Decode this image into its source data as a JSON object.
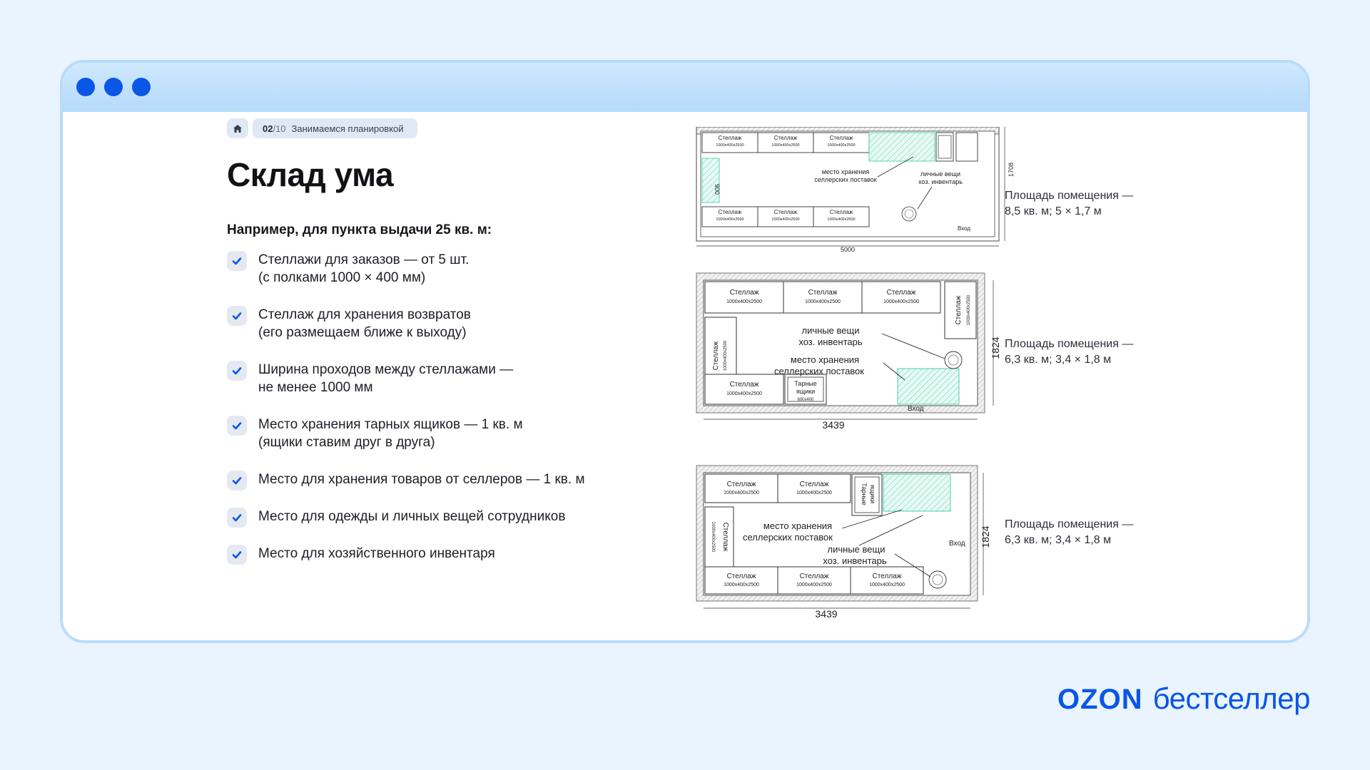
{
  "breadcrumb": {
    "step": "02",
    "total": "/10",
    "label": "Занимаемся планировкой"
  },
  "title": "Склад ума",
  "subtitle": "Например, для пункта выдачи 25 кв. м:",
  "checklist": [
    {
      "lines": [
        "Стеллажи для заказов — от 5 шт.",
        "(с полками 1000 × 400 мм)"
      ]
    },
    {
      "lines": [
        "Стеллаж для хранения возвратов",
        "(его размещаем ближе к выходу)"
      ]
    },
    {
      "lines": [
        "Ширина проходов между стеллажами —",
        "не менее 1000 мм"
      ]
    },
    {
      "lines": [
        "Место хранения тарных ящиков — 1 кв. м",
        "(ящики ставим друг в друга)"
      ]
    },
    {
      "lines": [
        "Место для хранения товаров от селлеров — 1 кв. м"
      ]
    },
    {
      "lines": [
        "Место для одежды и личных вещей сотрудников"
      ]
    },
    {
      "lines": [
        "Место для хозяйственного инвентаря"
      ]
    }
  ],
  "plans": {
    "rack": "Стеллаж",
    "rack_size": "1000х400х2500",
    "crates": [
      "Тарные",
      "ящики"
    ],
    "crates_size": "600х400",
    "storage": [
      "место хранения",
      "селлерских поставок"
    ],
    "personal": [
      "личные вещи",
      "хоз. инвентарь"
    ],
    "entrance": "Вход",
    "plan1": {
      "width": "5000",
      "height": "1708",
      "aisle": "900"
    },
    "plan2": {
      "width": "3439",
      "height": "1824"
    },
    "plan3": {
      "width": "3439",
      "height": "1824"
    }
  },
  "areas": [
    {
      "line1": "Площадь помещения —",
      "line2": "8,5 кв. м; 5 × 1,7 м"
    },
    {
      "line1": "Площадь помещения —",
      "line2": "6,3 кв. м; 3,4 × 1,8 м"
    },
    {
      "line1": "Площадь помещения —",
      "line2": "6,3 кв. м; 3,4 × 1,8 м"
    }
  ],
  "brand": {
    "ozon": "OZON",
    "suffix": "бестселлер"
  },
  "colors": {
    "accent": "#0a56e6",
    "hatch": "#3ccaa6"
  }
}
